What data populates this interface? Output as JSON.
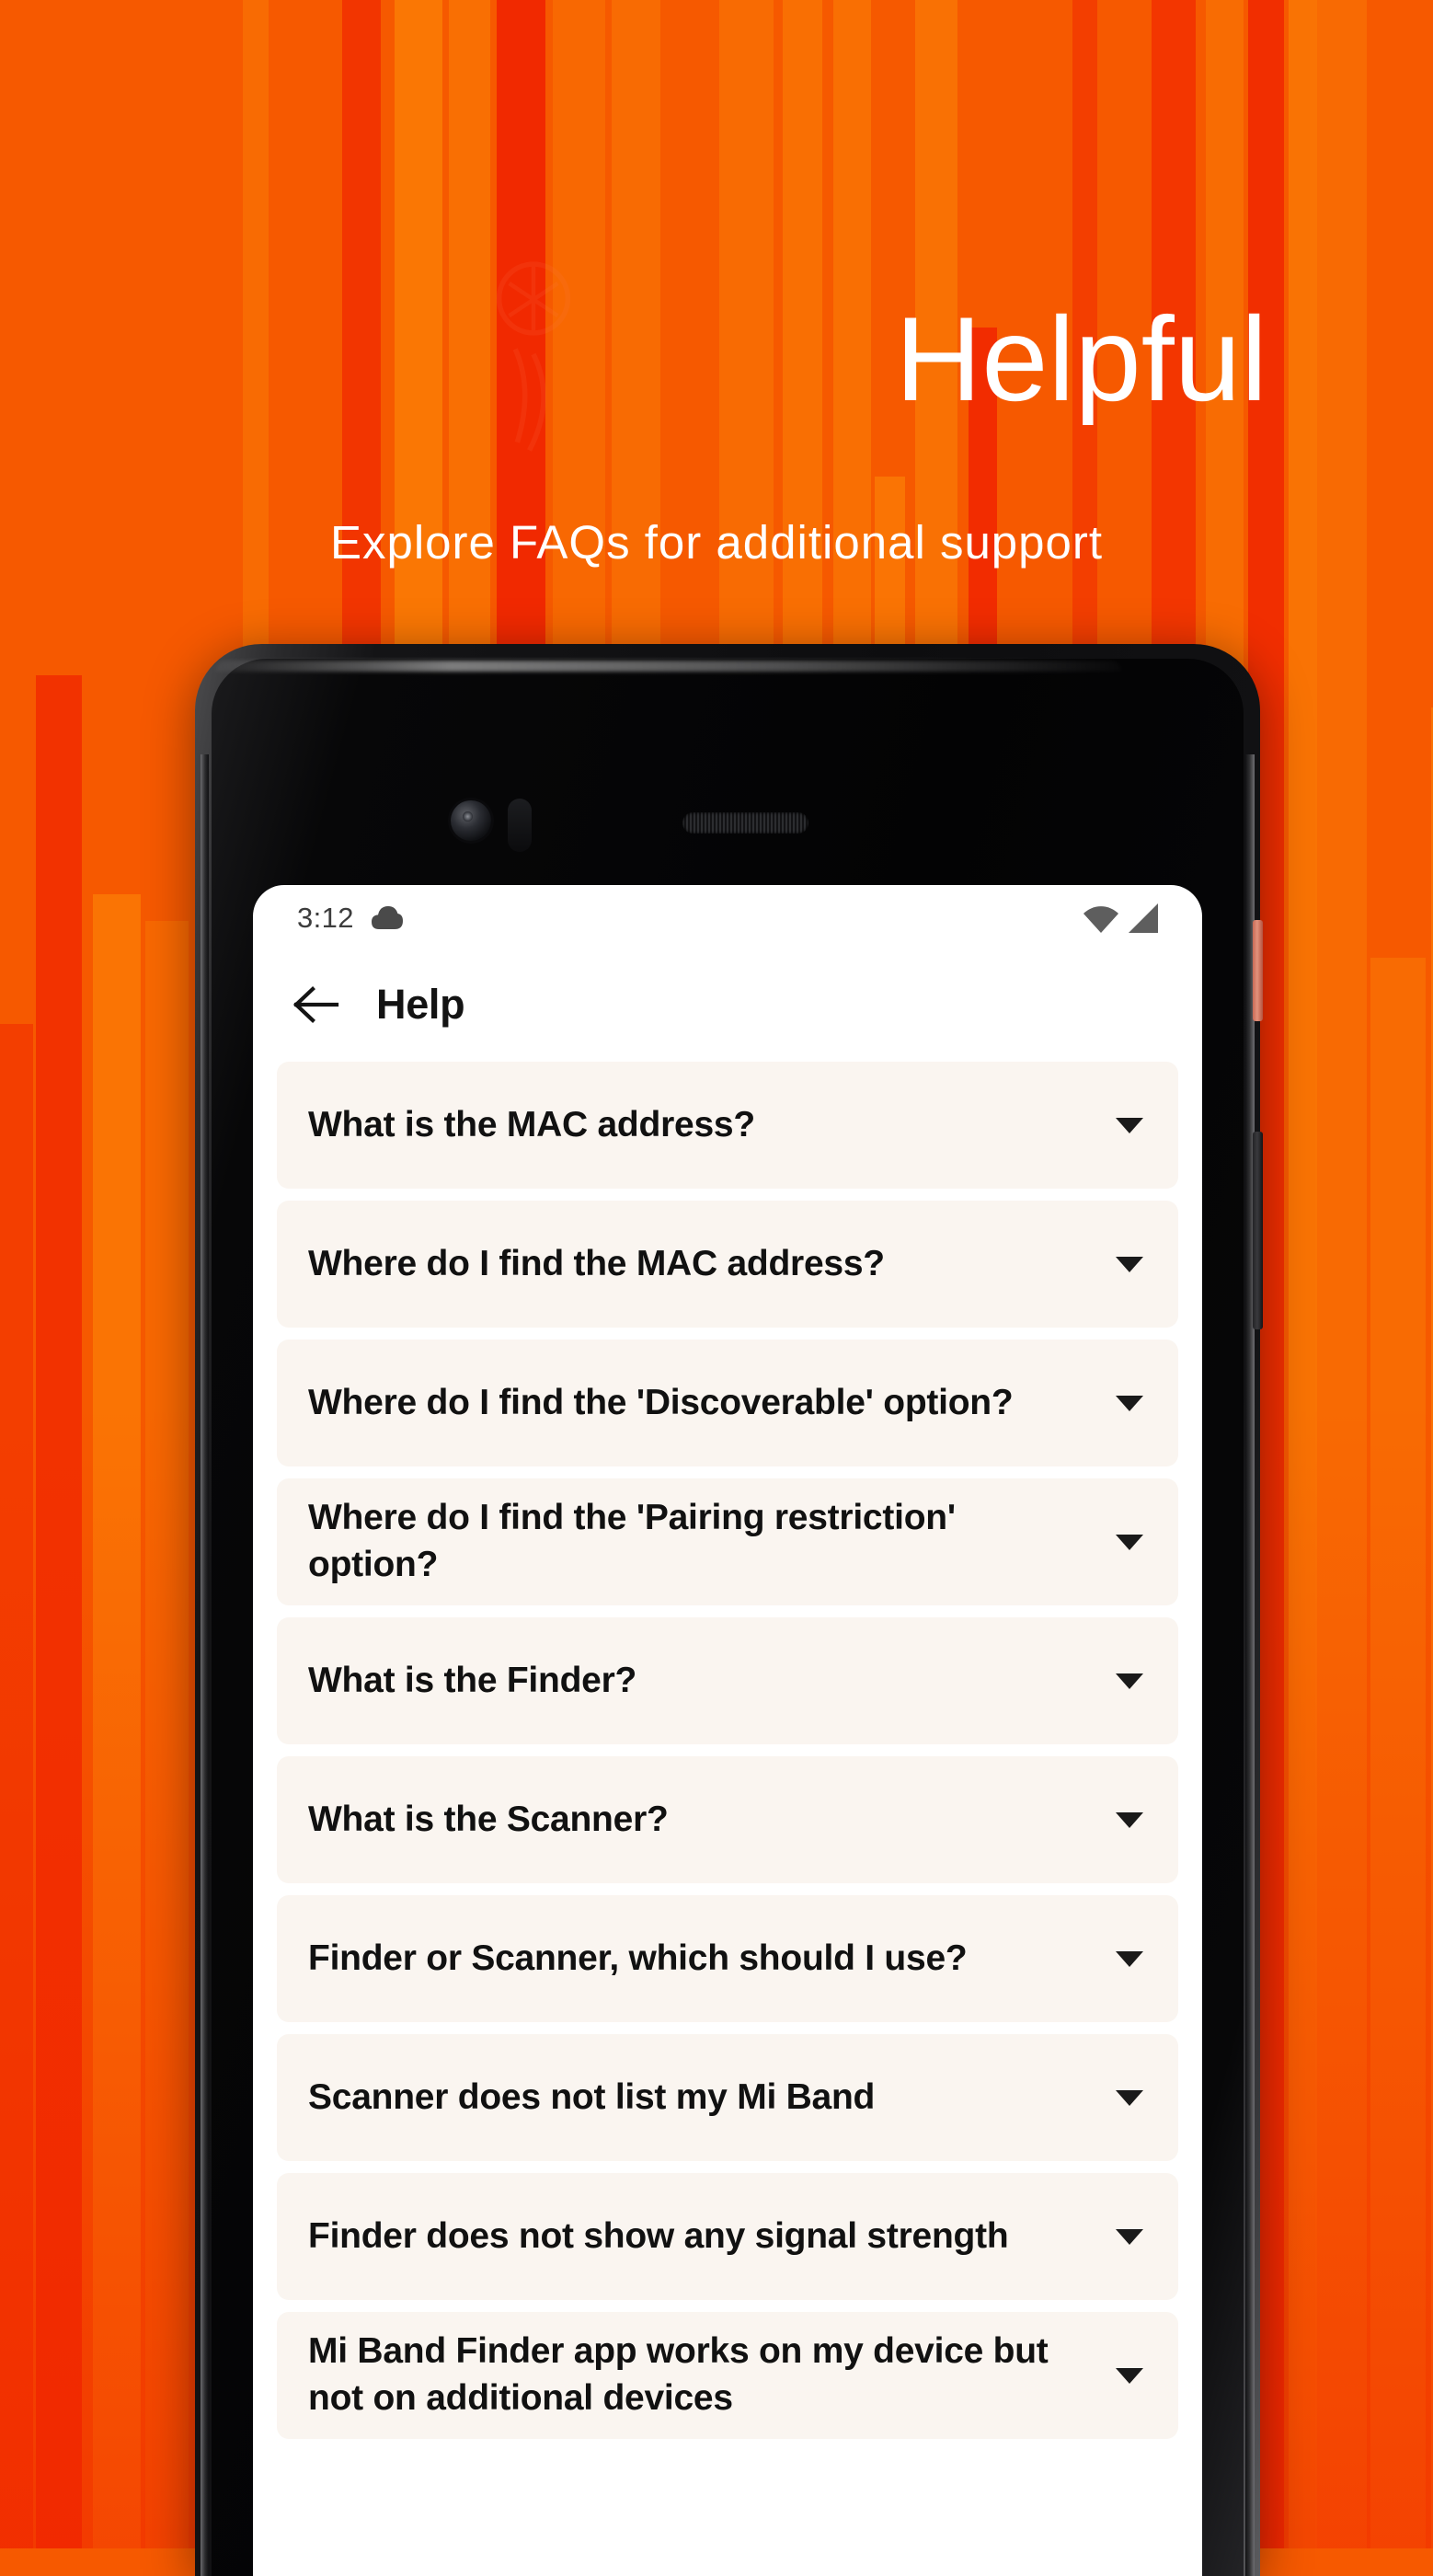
{
  "promo": {
    "headline": "Helpful",
    "subheadline": "Explore FAQs for additional support",
    "brand_orange": "#F65900",
    "bar_orange": "#FA7A05",
    "bar_red": "#F02200"
  },
  "phone": {
    "statusbar": {
      "clock": "3:12",
      "cloud_icon": "cloud-icon",
      "wifi_icon": "wifi-icon",
      "signal_icon": "signal-icon"
    },
    "appbar": {
      "back_icon": "back-arrow-icon",
      "title": "Help"
    },
    "faq": {
      "caret_icon": "chevron-down-icon",
      "items": [
        {
          "question": "What is the MAC address?"
        },
        {
          "question": "Where do I find the MAC address?"
        },
        {
          "question": "Where do I find the 'Discoverable' option?"
        },
        {
          "question": "Where do I find the 'Pairing restriction' option?"
        },
        {
          "question": "What is the Finder?"
        },
        {
          "question": "What is the Scanner?"
        },
        {
          "question": "Finder or Scanner, which should I use?"
        },
        {
          "question": "Scanner does not list my Mi Band"
        },
        {
          "question": "Finder does not show any signal strength"
        },
        {
          "question": "Mi Band Finder app works on my device but not on additional devices"
        }
      ]
    },
    "hardware": {
      "camera": "front-camera-icon",
      "sensor": "proximity-sensor-icon",
      "earpiece": "earpiece-speaker-icon",
      "power_button": "power-button",
      "volume_button": "volume-rocker"
    }
  }
}
